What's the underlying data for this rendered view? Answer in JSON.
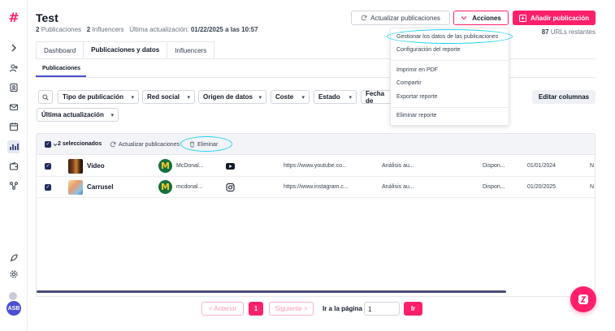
{
  "header": {
    "title": "Test",
    "pub_count": "2",
    "pub_label": "Publicaciones",
    "inf_count": "2",
    "inf_label": "Influencers",
    "updated_label": "Última actualización:",
    "updated_value": "01/22/2025 a las 10:57",
    "update_button": "Actualizar publicaciones",
    "actions_button": "Acciones",
    "add_button": "Añadir publicación",
    "urls_count": "87",
    "urls_label": "URLs restantes"
  },
  "tabs": [
    {
      "label": "Dashboard"
    },
    {
      "label": "Publicaciones y datos"
    },
    {
      "label": "Influencers"
    }
  ],
  "subtab": "Publicaciones",
  "filters": [
    {
      "label": "Tipo de publicación"
    },
    {
      "label": "Red social"
    },
    {
      "label": "Origen de datos"
    },
    {
      "label": "Coste"
    },
    {
      "label": "Estado"
    },
    {
      "label": "Fecha de"
    },
    {
      "label": "Última actualización"
    }
  ],
  "edit_columns": "Editar columnas",
  "toolbar": {
    "selected": "2 seleccionados",
    "refresh": "Actualizar publicaciones",
    "delete": "Eliminar"
  },
  "rows": [
    {
      "name": "Video",
      "brand": "McDonal...",
      "platform": "youtube",
      "url": "https://www.youtube.co...",
      "analysis": "Análisis au...",
      "availability": "Dispon...",
      "date": "01/01/2024",
      "extra": "N"
    },
    {
      "name": "Carrusel",
      "brand": "mcdonal...",
      "platform": "instagram",
      "url": "https://www.instagram.c...",
      "analysis": "Análisis au...",
      "availability": "Dispon...",
      "date": "01/20/2025",
      "extra": "N"
    }
  ],
  "pagination": {
    "prev": "< Anterior",
    "current": "1",
    "next": "Siguiente >",
    "goto_label": "Ir a la página",
    "goto_value": "1",
    "go": "Ir"
  },
  "menu": {
    "items": [
      "Gestionar los datos de las publicaciones",
      "Configuración del reporte",
      "Imprimir en PDF",
      "Compartir",
      "Exportar reporte",
      "Eliminar reporte"
    ]
  },
  "user": {
    "initials": "ASB"
  },
  "colors": {
    "accent": "#ff1f6b",
    "navy": "#1f2a63",
    "highlight": "#22d3ee",
    "indigo": "#4b4ecf"
  }
}
